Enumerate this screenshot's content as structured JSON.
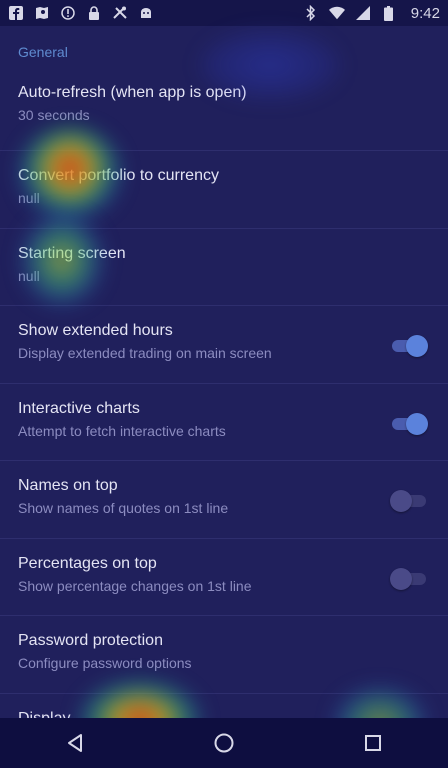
{
  "status_bar": {
    "time": "9:42",
    "left_icons": [
      "facebook-icon",
      "maps-icon",
      "info-icon",
      "lock-icon",
      "tools-icon",
      "android-icon"
    ],
    "right_icons": [
      "bluetooth-icon",
      "wifi-icon",
      "cellular-icon",
      "battery-icon"
    ]
  },
  "settings": {
    "section_general": "General",
    "auto_refresh": {
      "title": "Auto-refresh (when app is open)",
      "summary": "30 seconds"
    },
    "convert_portfolio": {
      "title": "Convert portfolio to currency",
      "summary": "null"
    },
    "starting_screen": {
      "title": "Starting screen",
      "summary": "null"
    },
    "extended_hours": {
      "title": "Show extended hours",
      "summary": "Display extended trading on main screen",
      "enabled": true
    },
    "interactive_charts": {
      "title": "Interactive charts",
      "summary": "Attempt to fetch interactive charts",
      "enabled": true
    },
    "names_on_top": {
      "title": "Names on top",
      "summary": "Show names of quotes on 1st line",
      "enabled": false
    },
    "percentages_on_top": {
      "title": "Percentages on top",
      "summary": "Show percentage changes on 1st line",
      "enabled": false
    },
    "password_protection": {
      "title": "Password protection",
      "summary": "Configure password options"
    },
    "display": {
      "title": "Display"
    }
  },
  "navigation": {
    "back": "back-icon",
    "home": "home-icon",
    "recents": "recents-icon"
  },
  "colors": {
    "background": "#20205c",
    "accent": "#5f8bd0",
    "switch_on": "#5b82dc"
  }
}
